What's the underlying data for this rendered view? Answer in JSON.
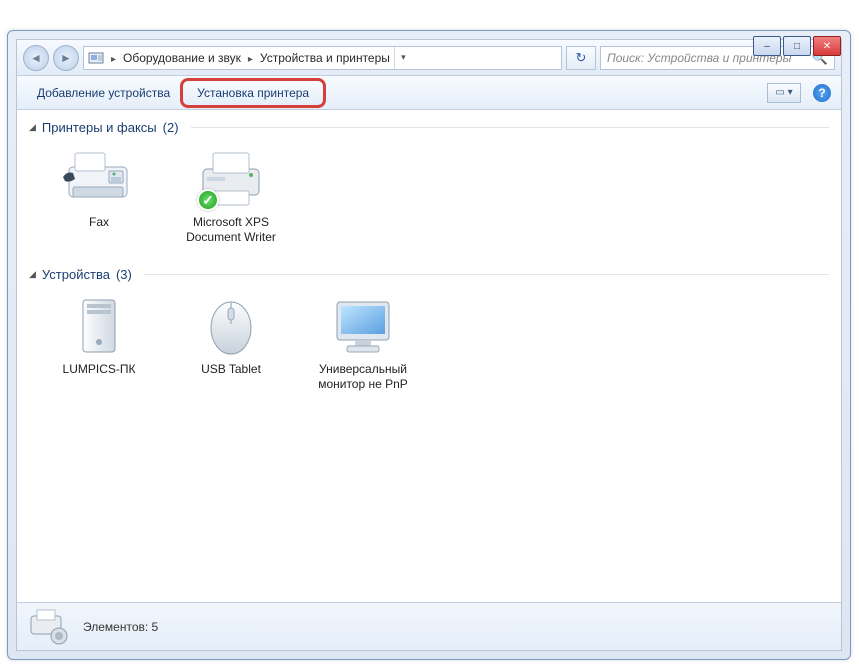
{
  "window": {
    "controls": {
      "min": "–",
      "max": "□",
      "close": "✕"
    }
  },
  "breadcrumb": {
    "icon_name": "devices-icon",
    "parts": [
      "Оборудование и звук",
      "Устройства и принтеры"
    ]
  },
  "search": {
    "placeholder": "Поиск: Устройства и принтеры"
  },
  "toolbar": {
    "add_device": "Добавление устройства",
    "add_printer": "Установка принтера"
  },
  "groups": [
    {
      "title": "Принтеры и факсы",
      "count": "(2)",
      "items": [
        {
          "icon": "fax",
          "label": "Fax",
          "default": false
        },
        {
          "icon": "printer",
          "label": "Microsoft XPS Document Writer",
          "default": true
        }
      ]
    },
    {
      "title": "Устройства",
      "count": "(3)",
      "items": [
        {
          "icon": "computer",
          "label": "LUMPICS-ПК"
        },
        {
          "icon": "mouse",
          "label": "USB Tablet"
        },
        {
          "icon": "monitor",
          "label": "Универсальный монитор не PnP"
        }
      ]
    }
  ],
  "status": {
    "label": "Элементов:",
    "count": "5"
  }
}
